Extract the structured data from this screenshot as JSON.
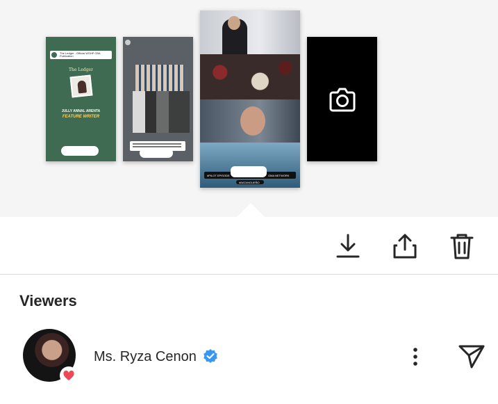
{
  "stories": {
    "thumb1": {
      "card_text": "The Ledger - Official WSHP CBA Publication",
      "title": "The Ledger",
      "name": "JULLY ANNAL ARENTA",
      "role": "FEATURE WRITER"
    },
    "thumb3": {
      "bar_left": "#PILOT EPISODE",
      "bar_right": "GMA NETWORK",
      "tag": "#BATANGUEÑO"
    },
    "camera": {
      "icon": "camera-icon"
    }
  },
  "toolbar": {
    "download_icon": "download-icon",
    "share_icon": "share-icon",
    "delete_icon": "trash-icon"
  },
  "viewers": {
    "title": "Viewers",
    "list": [
      {
        "name": "Ms. Ryza Cenon",
        "verified": true,
        "reaction": "heart",
        "more_icon": "more-vertical-icon",
        "send_icon": "send-icon"
      }
    ]
  },
  "colors": {
    "verified_blue": "#3897f0",
    "heart_red": "#ed4956",
    "text": "#262626",
    "divider": "#dbdbdb"
  }
}
